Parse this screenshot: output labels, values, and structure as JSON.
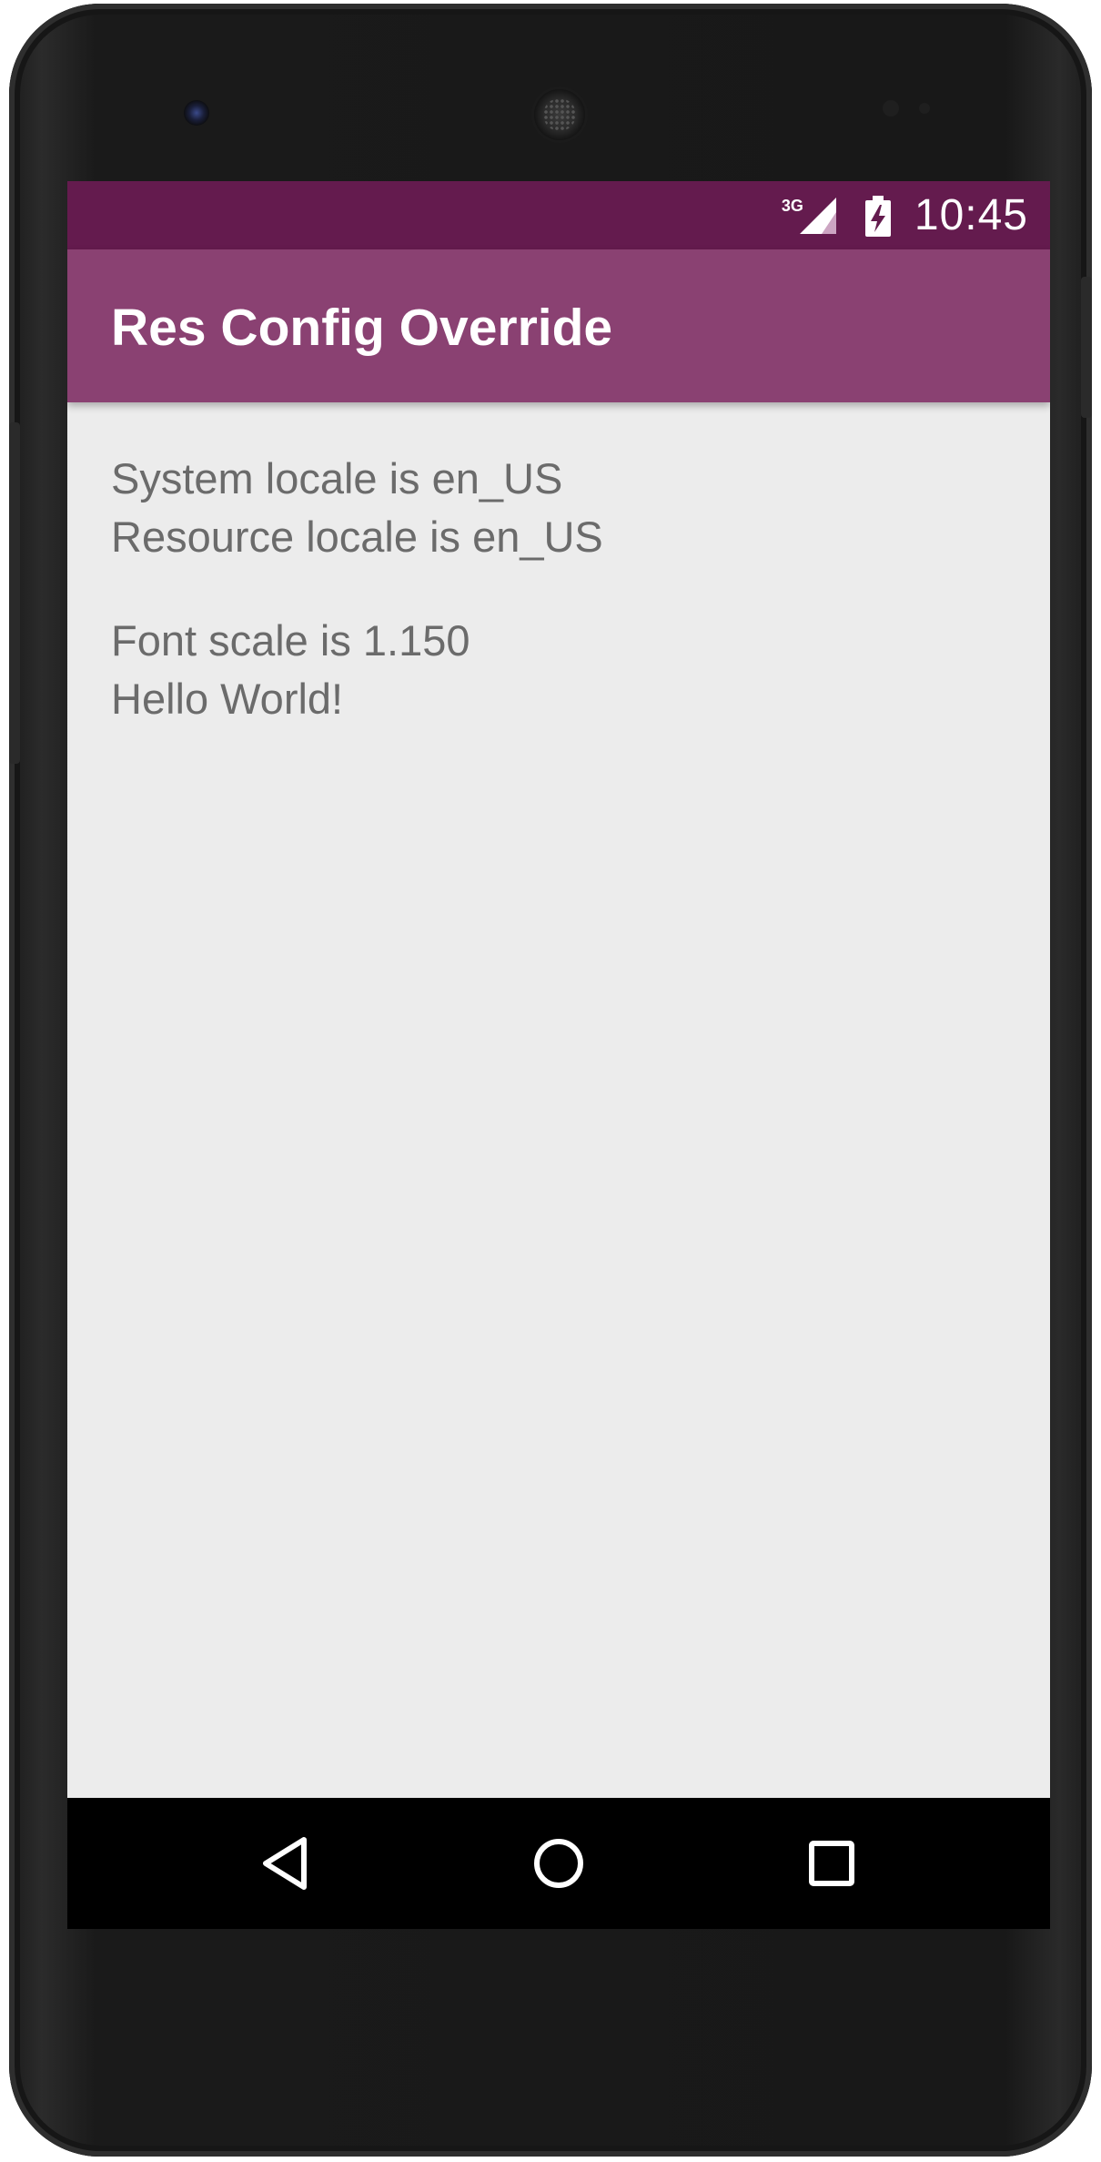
{
  "status_bar": {
    "network_type": "3G",
    "time": "10:45",
    "icons": [
      "signal-icon",
      "battery-charging-icon"
    ]
  },
  "app_bar": {
    "title": "Res Config Override"
  },
  "content": {
    "lines": [
      "System locale is en_US",
      "Resource locale is en_US",
      "Font scale is 1.150",
      "Hello World!"
    ]
  },
  "navigation": {
    "icons": [
      "back-icon",
      "home-icon",
      "recents-icon"
    ]
  },
  "colors": {
    "status_bar": "#641b4e",
    "app_bar": "#8a4172",
    "background": "#ececec",
    "text": "#6b6b6b"
  }
}
